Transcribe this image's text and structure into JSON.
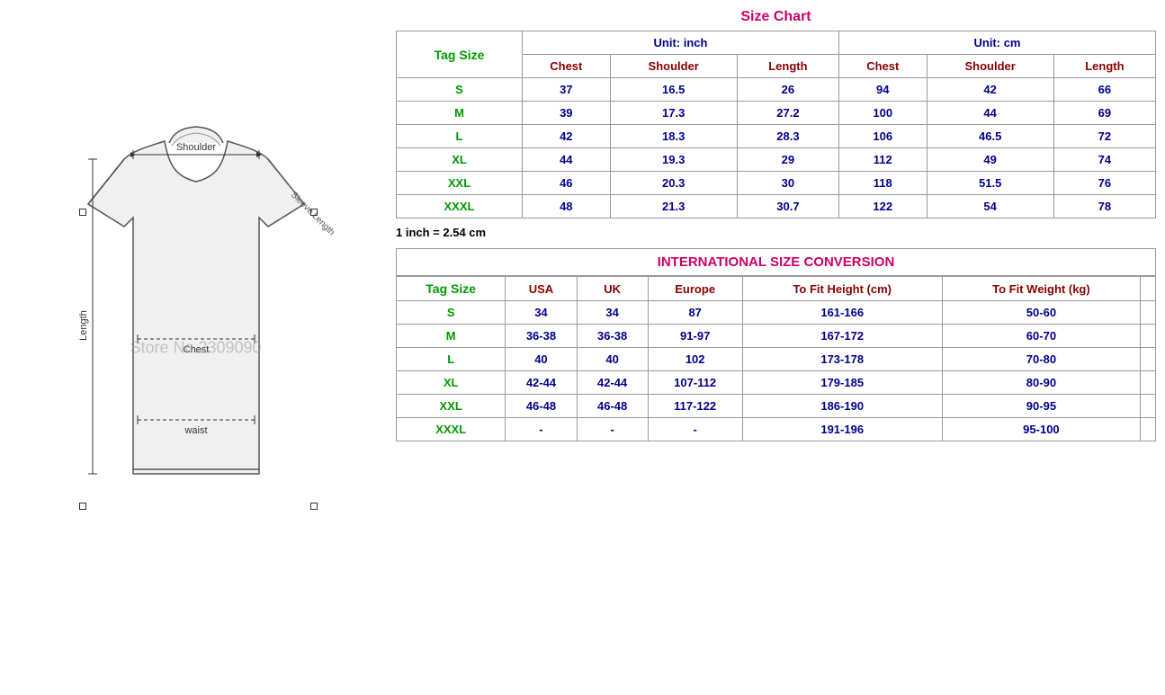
{
  "left": {
    "watermark": "Store No.2309090"
  },
  "right": {
    "size_chart_title": "Size Chart",
    "inch_note": "1 inch = 2.54 cm",
    "unit_inch": "Unit: inch",
    "unit_cm": "Unit: cm",
    "tag_size_label": "Tag Size",
    "col_headers": [
      "Chest",
      "Shoulder",
      "Length",
      "Chest",
      "Shoulder",
      "Length"
    ],
    "size_rows": [
      {
        "tag": "S",
        "chest_in": "37",
        "shoulder_in": "16.5",
        "length_in": "26",
        "chest_cm": "94",
        "shoulder_cm": "42",
        "length_cm": "66"
      },
      {
        "tag": "M",
        "chest_in": "39",
        "shoulder_in": "17.3",
        "length_in": "27.2",
        "chest_cm": "100",
        "shoulder_cm": "44",
        "length_cm": "69"
      },
      {
        "tag": "L",
        "chest_in": "42",
        "shoulder_in": "18.3",
        "length_in": "28.3",
        "chest_cm": "106",
        "shoulder_cm": "46.5",
        "length_cm": "72"
      },
      {
        "tag": "XL",
        "chest_in": "44",
        "shoulder_in": "19.3",
        "length_in": "29",
        "chest_cm": "112",
        "shoulder_cm": "49",
        "length_cm": "74"
      },
      {
        "tag": "XXL",
        "chest_in": "46",
        "shoulder_in": "20.3",
        "length_in": "30",
        "chest_cm": "118",
        "shoulder_cm": "51.5",
        "length_cm": "76"
      },
      {
        "tag": "XXXL",
        "chest_in": "48",
        "shoulder_in": "21.3",
        "length_in": "30.7",
        "chest_cm": "122",
        "shoulder_cm": "54",
        "length_cm": "78"
      }
    ],
    "conversion_title": "INTERNATIONAL SIZE CONVERSION",
    "conv_tag_size": "Tag Size",
    "conv_col_headers": [
      "USA",
      "UK",
      "Europe",
      "To Fit Height (cm)",
      "To Fit Weight (kg)"
    ],
    "conv_rows": [
      {
        "tag": "S",
        "usa": "34",
        "uk": "34",
        "europe": "87",
        "height": "161-166",
        "weight": "50-60"
      },
      {
        "tag": "M",
        "usa": "36-38",
        "uk": "36-38",
        "europe": "91-97",
        "height": "167-172",
        "weight": "60-70"
      },
      {
        "tag": "L",
        "usa": "40",
        "uk": "40",
        "europe": "102",
        "height": "173-178",
        "weight": "70-80"
      },
      {
        "tag": "XL",
        "usa": "42-44",
        "uk": "42-44",
        "europe": "107-112",
        "height": "179-185",
        "weight": "80-90"
      },
      {
        "tag": "XXL",
        "usa": "46-48",
        "uk": "46-48",
        "europe": "117-122",
        "height": "186-190",
        "weight": "90-95"
      },
      {
        "tag": "XXXL",
        "usa": "-",
        "uk": "-",
        "europe": "-",
        "height": "191-196",
        "weight": "95-100"
      }
    ]
  }
}
